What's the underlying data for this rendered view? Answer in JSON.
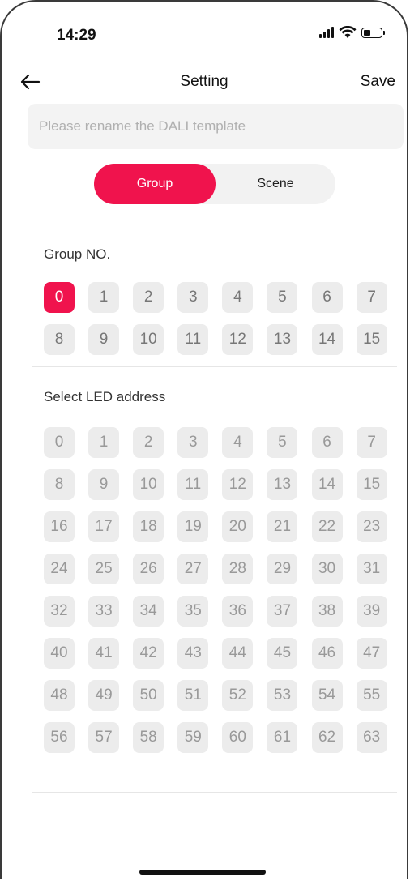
{
  "status_bar": {
    "time": "14:29"
  },
  "nav": {
    "title": "Setting",
    "save_label": "Save"
  },
  "rename": {
    "value": "",
    "placeholder": "Please rename the DALI template"
  },
  "segments": {
    "group_label": "Group",
    "scene_label": "Scene",
    "selected": "Group"
  },
  "group_section": {
    "label": "Group NO.",
    "selected": "0",
    "numbers": [
      "0",
      "1",
      "2",
      "3",
      "4",
      "5",
      "6",
      "7",
      "8",
      "9",
      "10",
      "11",
      "12",
      "13",
      "14",
      "15"
    ]
  },
  "led_section": {
    "label": "Select LED address",
    "numbers": [
      "0",
      "1",
      "2",
      "3",
      "4",
      "5",
      "6",
      "7",
      "8",
      "9",
      "10",
      "11",
      "12",
      "13",
      "14",
      "15",
      "16",
      "17",
      "18",
      "19",
      "20",
      "21",
      "22",
      "23",
      "24",
      "25",
      "26",
      "27",
      "28",
      "29",
      "30",
      "31",
      "32",
      "33",
      "34",
      "35",
      "36",
      "37",
      "38",
      "39",
      "40",
      "41",
      "42",
      "43",
      "44",
      "45",
      "46",
      "47",
      "48",
      "49",
      "50",
      "51",
      "52",
      "53",
      "54",
      "55",
      "56",
      "57",
      "58",
      "59",
      "60",
      "61",
      "62",
      "63"
    ]
  },
  "colors": {
    "accent": "#f0134d",
    "chip_bg": "#ececec",
    "field_bg": "#f3f3f3"
  },
  "icons": {
    "back": "arrow-left-icon",
    "signal": "signal-icon",
    "wifi": "wifi-icon",
    "battery": "battery-icon"
  }
}
